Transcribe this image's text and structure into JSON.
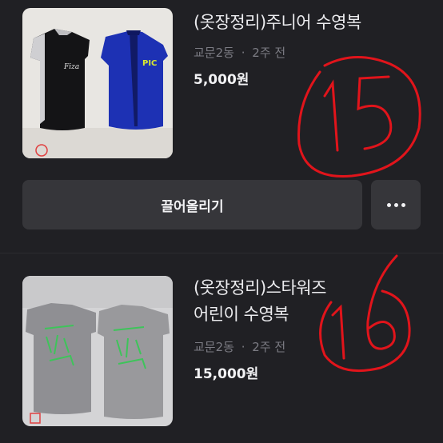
{
  "listings": [
    {
      "title": "(옷장정리)주니어 수영복",
      "location": "교문2동",
      "separator": "·",
      "time": "2주 전",
      "price": "5,000원",
      "handwritten_number": "15"
    },
    {
      "title": "(옷장정리)스타워즈\n어린이 수영복",
      "location": "교문2동",
      "separator": "·",
      "time": "2주 전",
      "price": "15,000원",
      "handwritten_number": "16"
    }
  ],
  "actions": {
    "bump_label": "끌어올리기",
    "more_icon": "more-horizontal-icon"
  },
  "colors": {
    "background": "#202024",
    "button": "#36363a",
    "annotation_red": "#e1141b"
  }
}
